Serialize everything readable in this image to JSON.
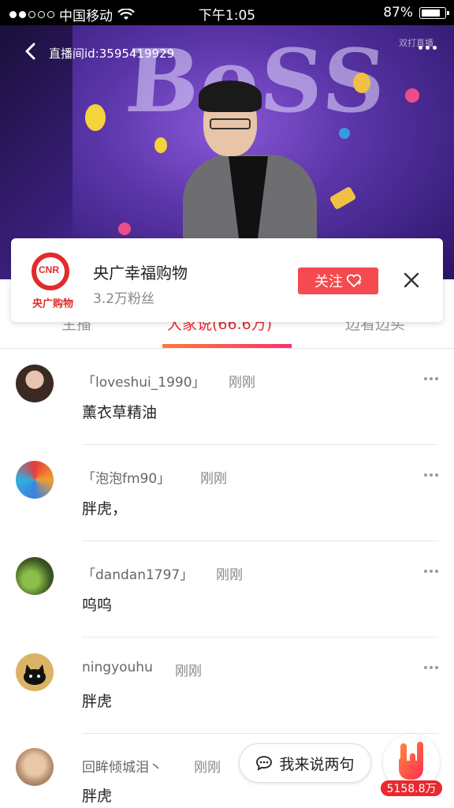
{
  "status_bar": {
    "carrier": "中国移动",
    "time": "下午1:05",
    "battery": "87%",
    "battery_level": 0.87
  },
  "video": {
    "room_id": "直播间id:3595419929",
    "watermark": "双打直播"
  },
  "follow_card": {
    "logo_text": "CNR",
    "logo_cn": "央广购物",
    "name": "央广幸福购物",
    "fans": "3.2万粉丝",
    "follow_label": "关注"
  },
  "tabs": [
    {
      "label": "主播"
    },
    {
      "label": "大家说(66.6万)"
    },
    {
      "label": "边看边买"
    }
  ],
  "comments": [
    {
      "user": "「loveshui_1990」",
      "time": "刚刚",
      "text": "薰衣草精油"
    },
    {
      "user": "「泡泡fm90」",
      "time": "刚刚",
      "text": "胖虎，"
    },
    {
      "user": "「dandan1797」",
      "time": "刚刚",
      "text": "呜呜"
    },
    {
      "user": "ningyouhu",
      "time": "刚刚",
      "text": "胖虎"
    },
    {
      "user": "回眸倾城泪丶",
      "time": "刚刚",
      "text": "胖虎"
    }
  ],
  "say_button": "我来说两句",
  "like_count": "5158.8万",
  "colors": {
    "accent": "#e8292e",
    "follow": "#f54a4f"
  }
}
